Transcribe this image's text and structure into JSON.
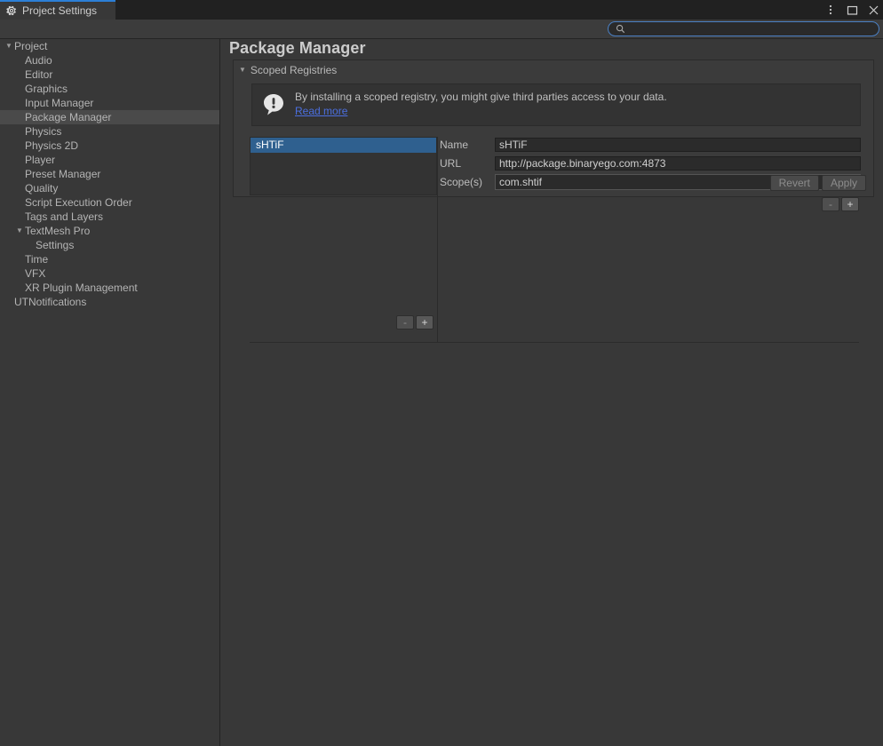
{
  "window": {
    "tab_label": "Project Settings",
    "tab_icon": "gear-icon",
    "menu_icon": "kebab-menu-icon",
    "maximize_icon": "maximize-icon",
    "close_icon": "close-icon"
  },
  "search": {
    "icon": "search-icon",
    "value": "",
    "placeholder": ""
  },
  "sidebar": {
    "items": [
      {
        "label": "Project",
        "indent": 0,
        "arrow": "▼",
        "selected": false
      },
      {
        "label": "Audio",
        "indent": 1,
        "arrow": "",
        "selected": false
      },
      {
        "label": "Editor",
        "indent": 1,
        "arrow": "",
        "selected": false
      },
      {
        "label": "Graphics",
        "indent": 1,
        "arrow": "",
        "selected": false
      },
      {
        "label": "Input Manager",
        "indent": 1,
        "arrow": "",
        "selected": false
      },
      {
        "label": "Package Manager",
        "indent": 1,
        "arrow": "",
        "selected": true
      },
      {
        "label": "Physics",
        "indent": 1,
        "arrow": "",
        "selected": false
      },
      {
        "label": "Physics 2D",
        "indent": 1,
        "arrow": "",
        "selected": false
      },
      {
        "label": "Player",
        "indent": 1,
        "arrow": "",
        "selected": false
      },
      {
        "label": "Preset Manager",
        "indent": 1,
        "arrow": "",
        "selected": false
      },
      {
        "label": "Quality",
        "indent": 1,
        "arrow": "",
        "selected": false
      },
      {
        "label": "Script Execution Order",
        "indent": 1,
        "arrow": "",
        "selected": false
      },
      {
        "label": "Tags and Layers",
        "indent": 1,
        "arrow": "",
        "selected": false
      },
      {
        "label": "TextMesh Pro",
        "indent": 1,
        "arrow": "▼",
        "selected": false
      },
      {
        "label": "Settings",
        "indent": 2,
        "arrow": "",
        "selected": false
      },
      {
        "label": "Time",
        "indent": 1,
        "arrow": "",
        "selected": false
      },
      {
        "label": "VFX",
        "indent": 1,
        "arrow": "",
        "selected": false
      },
      {
        "label": "XR Plugin Management",
        "indent": 1,
        "arrow": "",
        "selected": false
      },
      {
        "label": "UTNotifications",
        "indent": 0,
        "arrow": "",
        "selected": false
      }
    ]
  },
  "main": {
    "title": "Package Manager",
    "section": {
      "foldout_arrow": "▼",
      "foldout_label": "Scoped Registries",
      "warning": {
        "icon": "warning-exclamation-icon",
        "text": "By installing a scoped registry, you might give third parties access to your data.",
        "link": "Read more"
      },
      "registry_list": {
        "items": [
          {
            "name": "sHTiF",
            "selected": true
          }
        ],
        "remove_button": "-",
        "add_button": "+"
      },
      "detail": {
        "fields": [
          {
            "label": "Name",
            "value": "sHTiF"
          },
          {
            "label": "URL",
            "value": "http://package.binaryego.com:4873"
          },
          {
            "label": "Scope(s)",
            "value": "com.shtif"
          }
        ],
        "remove_button": "-",
        "add_button": "+"
      },
      "footer": {
        "revert_button": "Revert",
        "apply_button": "Apply"
      }
    }
  },
  "colors": {
    "window_bg": "#383838",
    "titlebar_bg": "#212121",
    "accent_tab": "#2c7fd6",
    "selection_blue": "#2f608f",
    "sidebar_selected": "#4a4a4a",
    "link_blue": "#4b6fe0",
    "search_border": "#4b80c4"
  }
}
